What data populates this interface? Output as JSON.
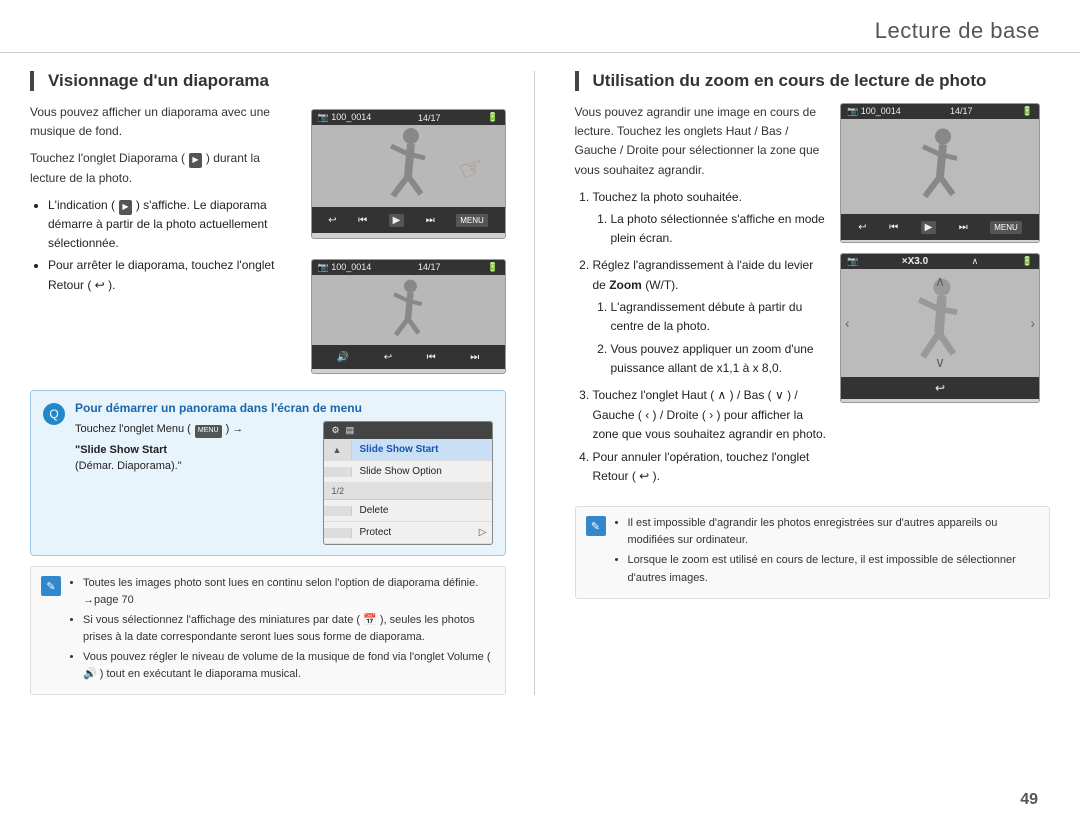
{
  "header": {
    "title": "Lecture de base"
  },
  "left_section": {
    "title": "Visionnage d'un diaporama",
    "para1": "Vous pouvez afficher un diaporama avec une musique de fond.",
    "para2": "Touchez l'onglet Diaporama (",
    "para2b": ") durant la lecture de la photo.",
    "bullets": [
      "L'indication (",
      ") s'affiche. Le diaporama démarre à partir de la photo actuellement sélectionnée.",
      "Pour arrêter le diaporama, touchez l'onglet Retour ("
    ],
    "bullet1_text": "L'indication ( ■ ) s'affiche. Le diaporama démarre à partir de la photo actuellement sélectionnée.",
    "bullet2_text": "Pour arrêter le diaporama, touchez l'onglet Retour ( ↩ ).",
    "camera1": {
      "counter": "14/17",
      "folder": "100_0014",
      "menu_label": "MENU"
    },
    "camera2": {
      "counter": "14/17",
      "folder": "100_0014"
    },
    "blue_box": {
      "title": "Pour démarrer un panorama dans l'écran de menu",
      "instruction_prefix": "Touchez l'onglet Menu (",
      "instruction_menu": "MENU",
      "instruction_suffix": ") →",
      "bold_text": "\"Slide Show Start",
      "normal_text": "(Démar. Diaporama).\"",
      "menu_items": [
        {
          "label": "Slide Show Start",
          "highlighted": true
        },
        {
          "label": "Slide Show Option",
          "highlighted": false
        },
        {
          "label": "Delete",
          "highlighted": false
        },
        {
          "label": "Protect",
          "highlighted": false
        }
      ],
      "page_indicator": "1/2"
    },
    "note_bullets": [
      "Toutes les images photo sont lues en continu selon l'option de diaporama définie. →page 70",
      "Si vous sélectionnez l'affichage des miniatures par date ( 📅 ), seules les photos prises à la date correspondante seront lues sous forme de diaporama.",
      "Vous pouvez régler le niveau de volume de la musique de fond via l'onglet Volume ( 🔊 ) tout en exécutant le diaporama musical."
    ]
  },
  "right_section": {
    "title": "Utilisation du zoom en cours de lecture de photo",
    "para1": "Vous pouvez agrandir une image en cours de lecture. Touchez les onglets Haut / Bas / Gauche / Droite pour sélectionner la zone que vous souhaitez agrandir.",
    "numbered": [
      "Touchez la photo souhaitée.",
      "Réglez l'agrandissement à l'aide du levier de Zoom (W/T).",
      "Touchez l'onglet Haut ( ∧ ) / Bas ( ∨ ) / Gauche ( ‹ ) / Droite ( › ) pour afficher la zone que vous souhaitez agrandir en photo.",
      "Pour annuler l'opération, touchez l'onglet Retour ( ↩ )."
    ],
    "sub_bullet1": "La photo sélectionnée s'affiche en mode plein écran.",
    "sub_bullet2_prefix": "L'agrandissement débute à partir du centre de la photo.",
    "sub_bullet3": "Vous pouvez appliquer un zoom d'une puissance allant de x1,1 à x 8,0.",
    "zoom_label": "×X3.0",
    "camera1": {
      "counter": "14/17",
      "folder": "100_0014",
      "menu_label": "MENU"
    },
    "note_bullets": [
      "Il est impossible d'agrandir les photos enregistrées sur d'autres appareils ou modifiées sur ordinateur.",
      "Lorsque le zoom est utilisé en cours de lecture, il est impossible de sélectionner d'autres images."
    ]
  },
  "page_number": "49"
}
